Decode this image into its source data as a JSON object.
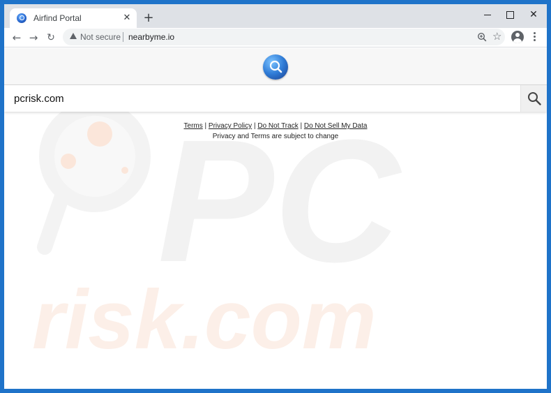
{
  "browser": {
    "tab": {
      "title": "Airfind Portal",
      "close_glyph": "✕"
    },
    "new_tab_glyph": "+",
    "window_controls": {
      "minimize": "",
      "maximize": "",
      "close": "✕"
    },
    "nav": {
      "back": "←",
      "forward": "→",
      "reload": "↻"
    },
    "address": {
      "security_label": "Not secure",
      "url": "nearbyme.io"
    },
    "star_glyph": "☆"
  },
  "page": {
    "search": {
      "value": "pcrisk.com",
      "placeholder": ""
    },
    "footer": {
      "links": [
        "Terms",
        "Privacy Policy",
        "Do Not Track",
        "Do Not Sell My Data"
      ],
      "separator": "|",
      "note": "Privacy and Terms are subject to change"
    },
    "watermark": {
      "text_top": "PC",
      "text_bottom": "risk.com"
    }
  },
  "colors": {
    "window_frame": "#1f73c9",
    "tabstrip": "#dee1e6",
    "logo_accent": "#2f7bd6",
    "watermark": "#f2f2f2",
    "watermark_accent": "#fbe3d6"
  }
}
